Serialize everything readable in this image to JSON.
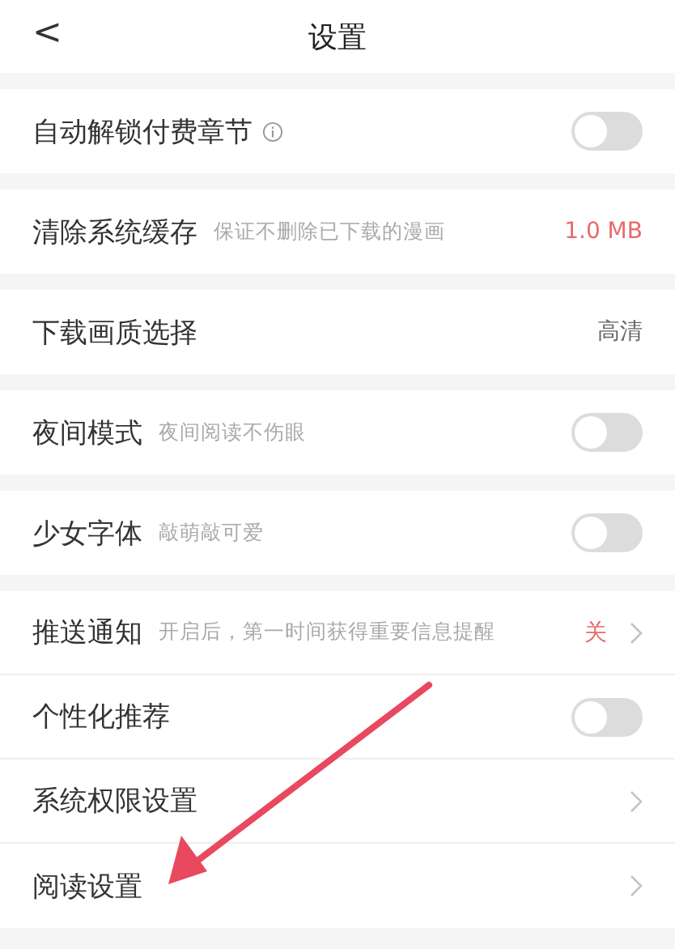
{
  "header": {
    "back": "<",
    "title": "设置"
  },
  "sections": [
    {
      "items": [
        {
          "kind": "toggle",
          "label": "自动解锁付费章节",
          "info": true,
          "on": false
        }
      ]
    },
    {
      "items": [
        {
          "kind": "value",
          "label": "清除系统缓存",
          "hint": "保证不删除已下载的漫画",
          "value": "1.0 MB",
          "color": "#e86a6a"
        }
      ]
    },
    {
      "items": [
        {
          "kind": "value",
          "label": "下载画质选择",
          "value": "高清",
          "color": "#666666"
        }
      ]
    },
    {
      "items": [
        {
          "kind": "toggle",
          "label": "夜间模式",
          "hint": "夜间阅读不伤眼",
          "on": false
        }
      ]
    },
    {
      "items": [
        {
          "kind": "toggle",
          "label": "少女字体",
          "hint": "敲萌敲可爱",
          "on": false
        }
      ]
    },
    {
      "items": [
        {
          "kind": "link",
          "label": "推送通知",
          "hint": "开启后，第一时间获得重要信息提醒",
          "value": "关",
          "color": "#e86a6a"
        },
        {
          "kind": "toggle",
          "label": "个性化推荐",
          "on": false
        },
        {
          "kind": "link",
          "label": "系统权限设置"
        },
        {
          "kind": "link",
          "label": "阅读设置"
        }
      ]
    }
  ]
}
